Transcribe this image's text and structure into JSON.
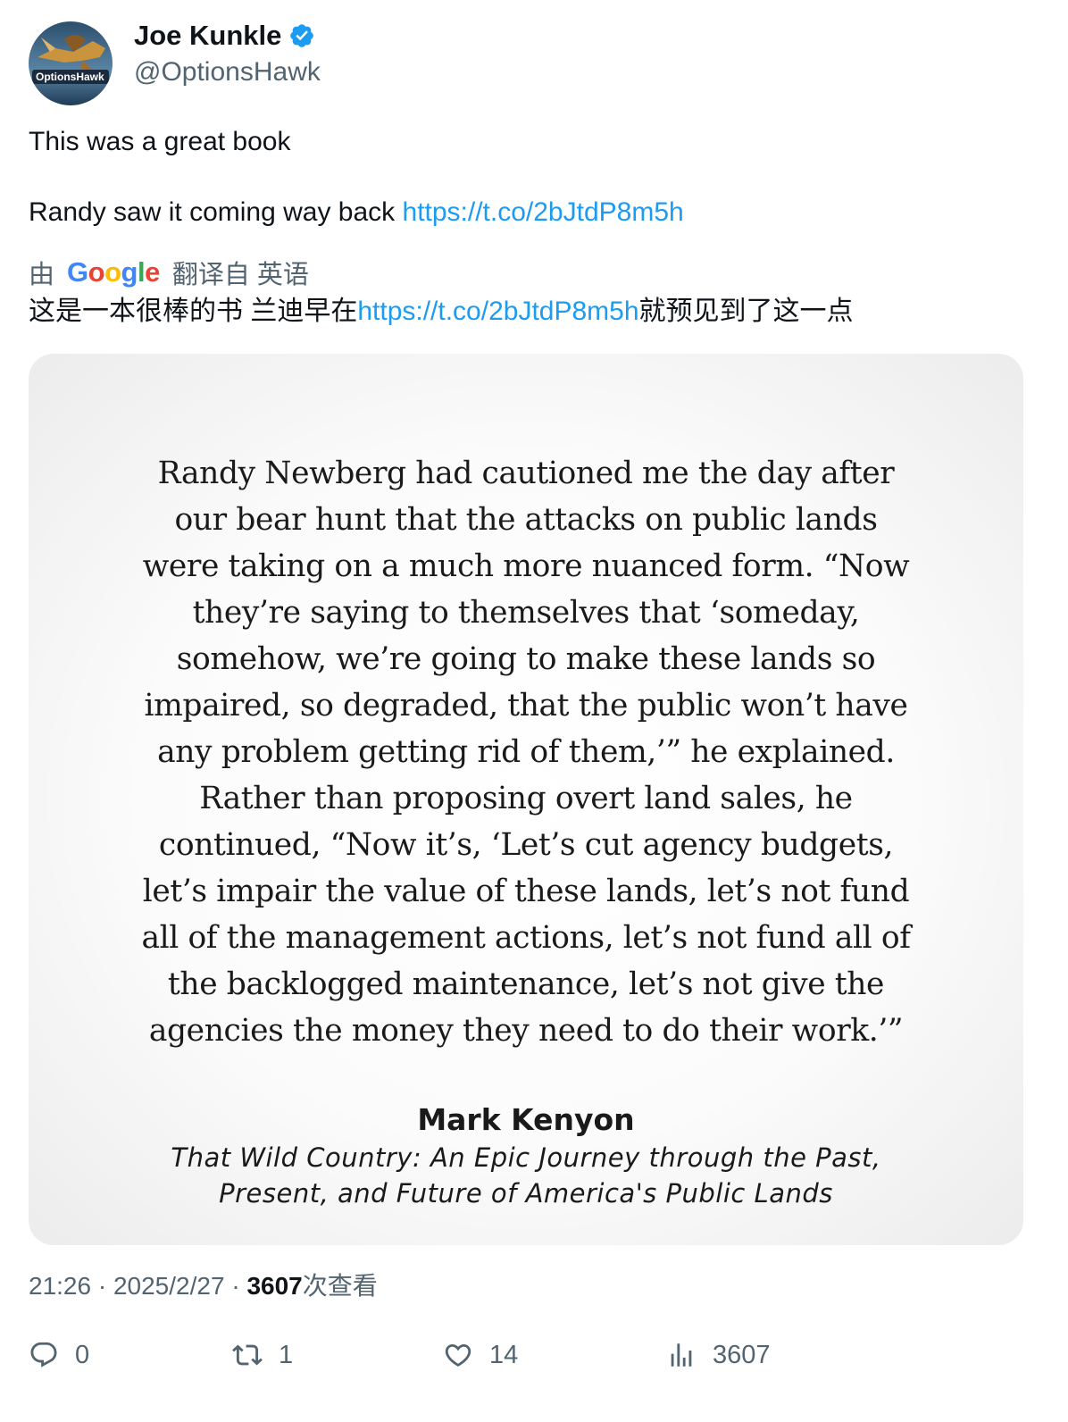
{
  "author": {
    "display_name": "Joe Kunkle",
    "handle": "@OptionsHawk",
    "avatar_text": "OptionsHawk",
    "verified": true
  },
  "tweet": {
    "line1": "This was a great book",
    "line2_text": "Randy saw it coming way back ",
    "link": "https://t.co/2bJtdP8m5h"
  },
  "translation": {
    "by": "由",
    "google": "Google",
    "from_label": "翻译自 英语",
    "text_before": "这是一本很棒的书 兰迪早在",
    "link": "https://t.co/2bJtdP8m5h",
    "text_after": "就预见到了这一点"
  },
  "media": {
    "quote_lines": [
      "Randy Newberg had cautioned me the day after",
      "our bear hunt that the attacks on public lands",
      "were taking on a much more nuanced form. “Now",
      "they’re saying to themselves that ‘someday,",
      "somehow, we’re going to make these lands so",
      "impaired, so degraded, that the public won’t have",
      "any problem getting rid of them,’” he explained.",
      "Rather than proposing overt land sales, he",
      "continued, “Now it’s, ‘Let’s cut agency budgets,",
      "let’s impair the value of these lands, let’s not fund",
      "all of the management actions, let’s not fund all of",
      "the backlogged maintenance, let’s not give the",
      "agencies the money they need to do their work.’”"
    ],
    "author": "Mark Kenyon",
    "book_line1": "That Wild Country: An Epic Journey through the Past,",
    "book_line2": "Present, and Future of America's Public Lands"
  },
  "meta": {
    "time": "21:26",
    "sep": " · ",
    "date": "2025/2/27",
    "views_count": "3607",
    "views_label": "次查看"
  },
  "actions": {
    "replies": "0",
    "retweets": "1",
    "likes": "14",
    "views": "3607"
  },
  "colors": {
    "link": "#1d9bf0",
    "secondary_text": "#536471",
    "verified": "#1d9bf0"
  }
}
